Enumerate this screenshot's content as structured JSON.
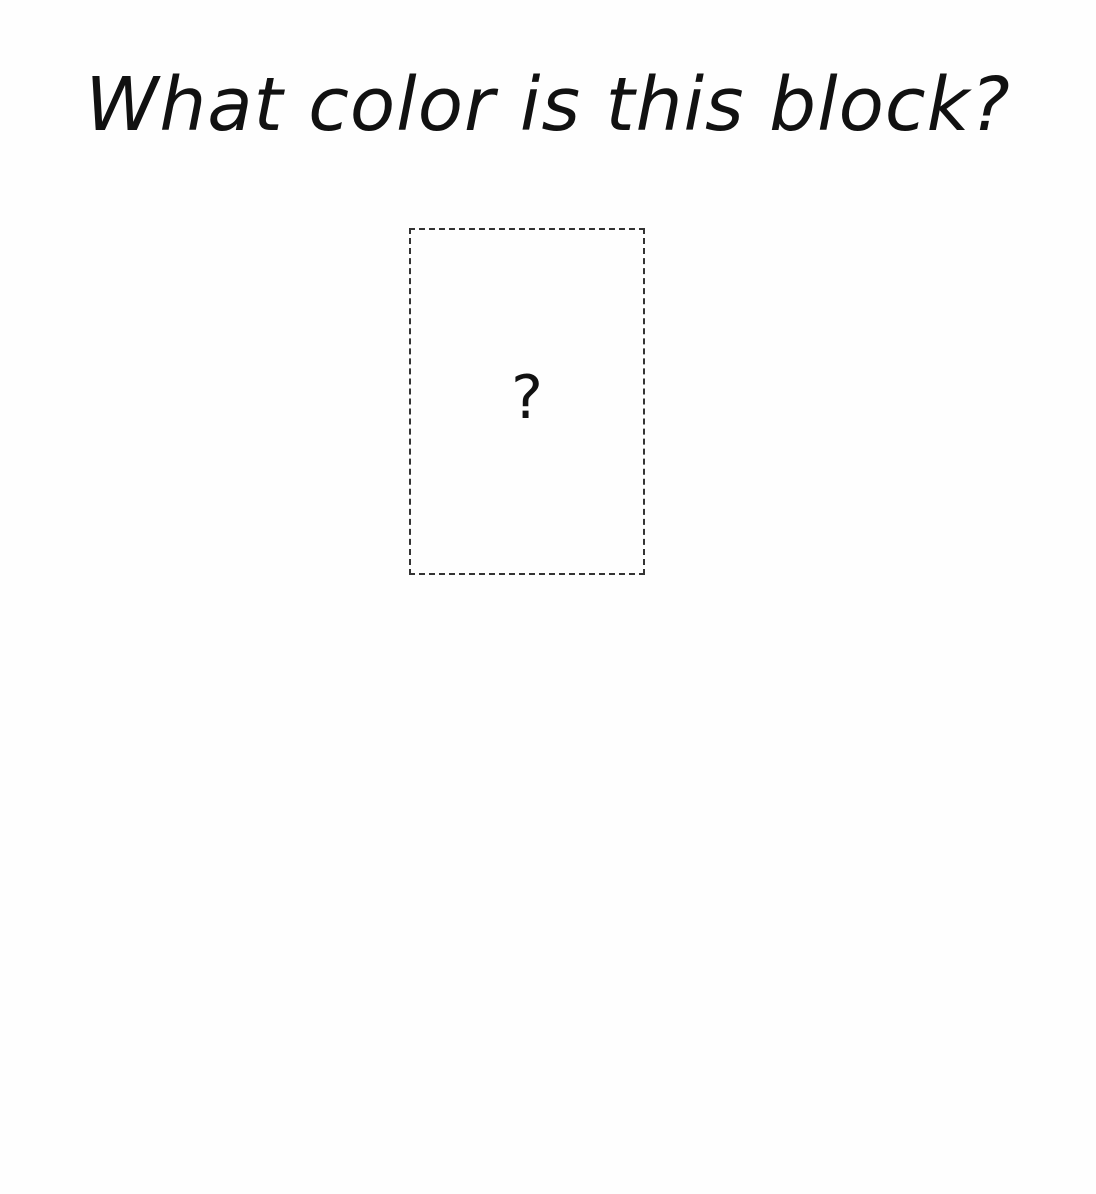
{
  "question": {
    "text": "What color is this block?"
  },
  "block": {
    "mark": "?",
    "border_color": "#333333"
  }
}
